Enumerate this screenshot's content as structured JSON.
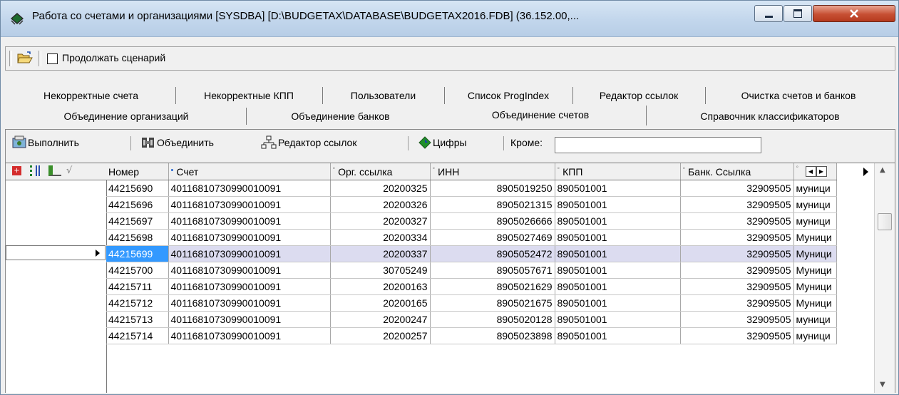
{
  "window": {
    "title": "Работа со счетами и организациями [SYSDBA] [D:\\BUDGETAX\\DATABASE\\BUDGETAX2016.FDB] (36.152.00,..."
  },
  "toolbar_top": {
    "continue_scenario_label": "Продолжать сценарий",
    "continue_scenario_checked": false
  },
  "tabs_row1": [
    "Некорректные счета",
    "Некорректные КПП",
    "Пользователи",
    "Список ProgIndex",
    "Редактор ссылок",
    "Очистка счетов и банков"
  ],
  "tabs_row2": [
    "Объединение организаций",
    "Объединение банков",
    "Объединение счетов",
    "Справочник классификаторов"
  ],
  "active_tab": "Объединение счетов",
  "actions": {
    "execute": "Выполнить",
    "merge": "Объединить",
    "link_editor": "Редактор ссылок",
    "digits": "Цифры",
    "except_label": "Кроме:",
    "except_value": ""
  },
  "grid": {
    "columns": [
      "Номер",
      "Счет",
      "Орг. ссылка",
      "ИНН",
      "КПП",
      "Банк. Ссылка",
      ""
    ],
    "rows": [
      [
        "44215690",
        "40116810730990010091",
        "20200325",
        "8905019250",
        "890501001",
        "32909505",
        "муници"
      ],
      [
        "44215696",
        "40116810730990010091",
        "20200326",
        "8905021315",
        "890501001",
        "32909505",
        "муници"
      ],
      [
        "44215697",
        "40116810730990010091",
        "20200327",
        "8905026666",
        "890501001",
        "32909505",
        "муници"
      ],
      [
        "44215698",
        "40116810730990010091",
        "20200334",
        "8905027469",
        "890501001",
        "32909505",
        "Муници"
      ],
      [
        "44215699",
        "40116810730990010091",
        "20200337",
        "8905052472",
        "890501001",
        "32909505",
        "Муници"
      ],
      [
        "44215700",
        "40116810730990010091",
        "30705249",
        "8905057671",
        "890501001",
        "32909505",
        "Муници"
      ],
      [
        "44215711",
        "40116810730990010091",
        "20200163",
        "8905021629",
        "890501001",
        "32909505",
        "Муници"
      ],
      [
        "44215712",
        "40116810730990010091",
        "20200165",
        "8905021675",
        "890501001",
        "32909505",
        "Муници"
      ],
      [
        "44215713",
        "40116810730990010091",
        "20200247",
        "8905020128",
        "890501001",
        "32909505",
        "муници"
      ],
      [
        "44215714",
        "40116810730990010091",
        "20200257",
        "8905023898",
        "890501001",
        "32909505",
        "муници"
      ]
    ],
    "selected_row_index": 4
  },
  "colors": {
    "selection": "#3399ff",
    "selected_row": "#dcdcf0",
    "titlebar": "#c2d6ec",
    "close_button": "#c74f33"
  }
}
